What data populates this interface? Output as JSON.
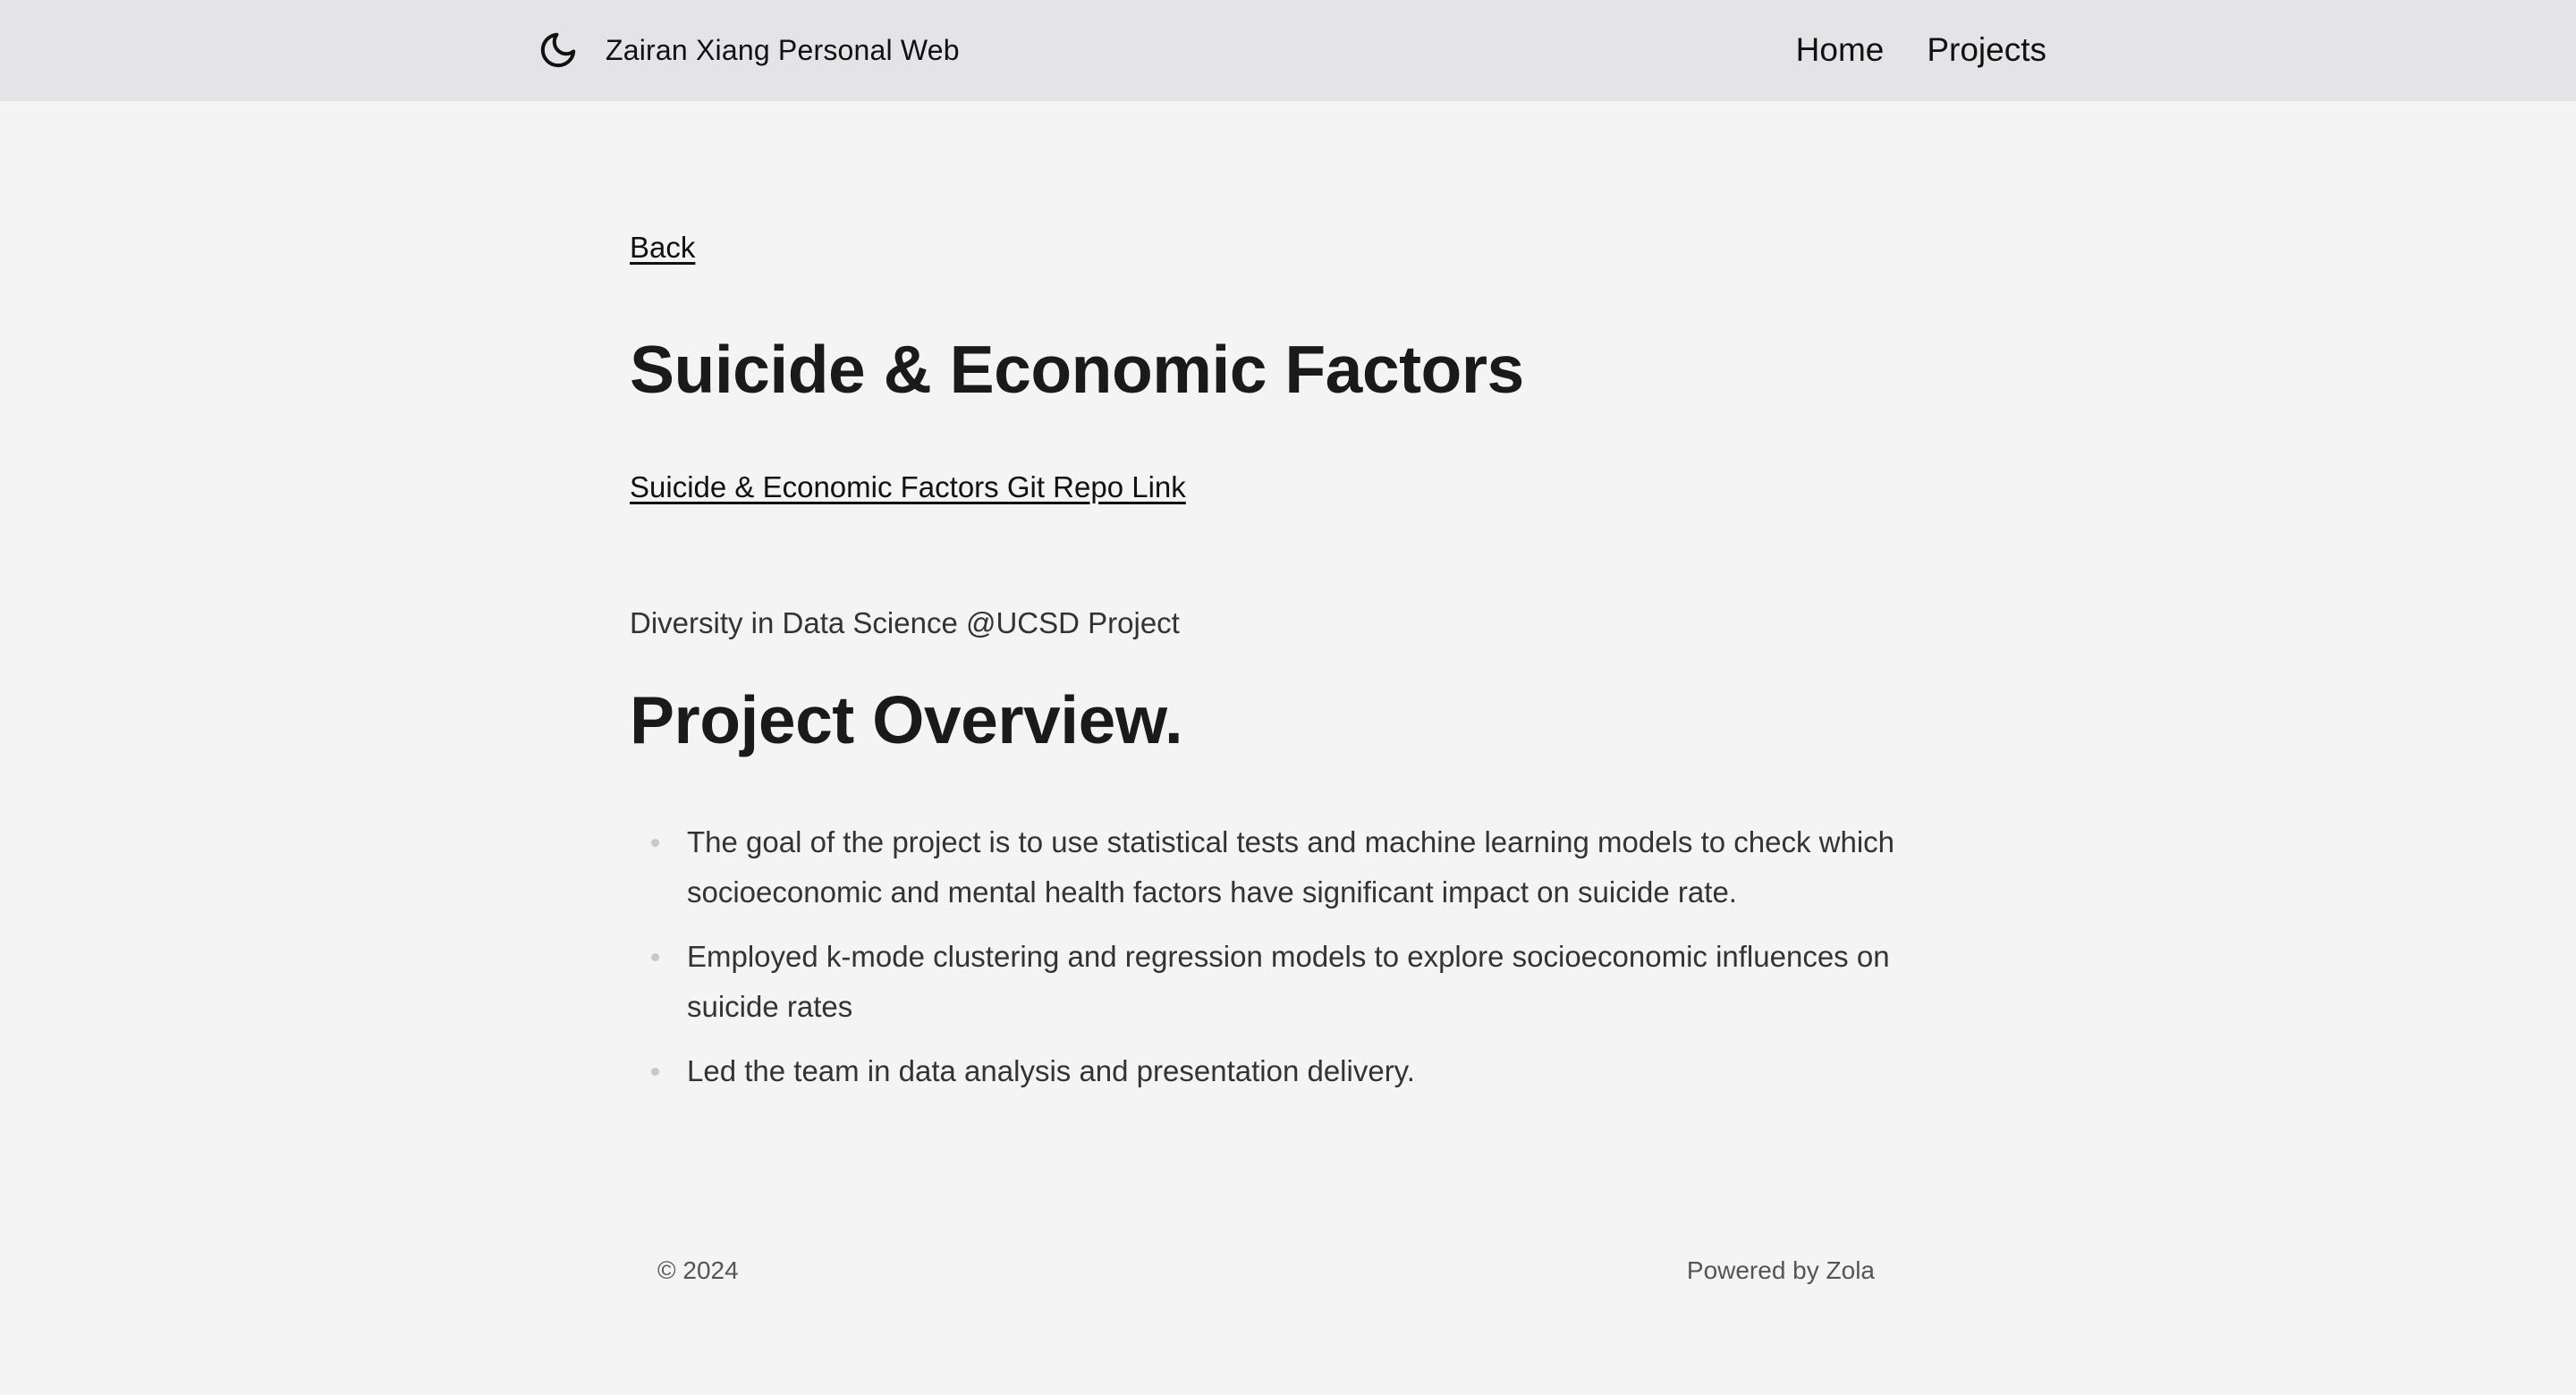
{
  "header": {
    "site_name": "Zairan Xiang Personal Web",
    "theme_icon": "moon-icon",
    "nav": [
      {
        "label": "Home"
      },
      {
        "label": "Projects"
      }
    ]
  },
  "page": {
    "back_label": "Back",
    "title": "Suicide & Economic Factors",
    "repo_link_label": "Suicide & Economic Factors Git Repo Link",
    "subtitle": "Diversity in Data Science @UCSD Project",
    "section_heading": "Project Overview.",
    "bullets": [
      "The goal of the project is to use statistical tests and machine learning models to check which socioeconomic and mental health factors have significant impact on suicide rate.",
      "Employed k-mode clustering and regression models to explore socioeconomic influences on suicide rates",
      "Led the team in data analysis and presentation delivery."
    ]
  },
  "footer": {
    "copyright": "© 2024",
    "powered_by": "Powered by Zola"
  }
}
